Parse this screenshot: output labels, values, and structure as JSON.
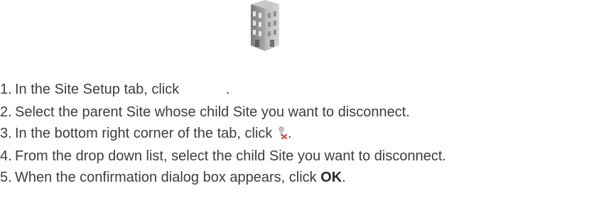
{
  "steps": [
    {
      "num": "1.",
      "text_before": "In the Site Setup tab, click",
      "text_after": "."
    },
    {
      "num": "2.",
      "text": "Select the parent Site whose child Site you want to disconnect."
    },
    {
      "num": "3.",
      "text_before": "In the bottom right corner of the tab, click",
      "text_after": "."
    },
    {
      "num": "4.",
      "text": "From the drop down list, select the child Site you want to disconnect."
    },
    {
      "num": "5.",
      "text_before": "When the confirmation dialog box appears, click",
      "bold": "OK",
      "text_after": "."
    }
  ],
  "icons": {
    "step1": "building-icon",
    "step3": "disconnect-site-icon"
  },
  "colors": {
    "text": "#3d3d3d",
    "building": "#9a9a9a"
  }
}
